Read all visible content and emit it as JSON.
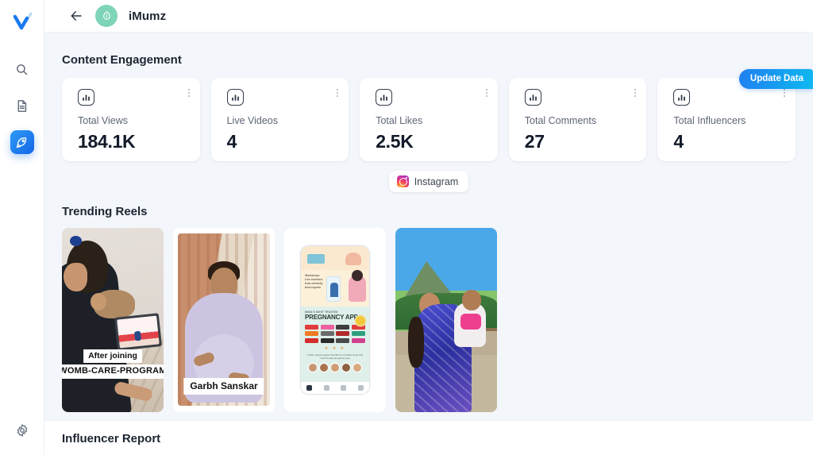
{
  "sidebar": {
    "logo_icon": "checkmark-logo",
    "items": [
      {
        "icon": "search-icon",
        "active": false
      },
      {
        "icon": "document-icon",
        "active": false
      },
      {
        "icon": "rocket-icon",
        "active": true
      }
    ],
    "bottom": {
      "icon": "gear-icon"
    }
  },
  "topbar": {
    "back_icon": "arrow-left-icon",
    "avatar_icon": "imumz-avatar-icon",
    "title": "iMumz"
  },
  "update_tab": {
    "label": "Update Data"
  },
  "sections": {
    "engagement_title": "Content Engagement",
    "reels_title": "Trending Reels",
    "report_title": "Influencer Report"
  },
  "stats": [
    {
      "icon": "bar-chart-icon",
      "label": "Total Views",
      "value": "184.1K"
    },
    {
      "icon": "bar-chart-icon",
      "label": "Live Videos",
      "value": "4"
    },
    {
      "icon": "bar-chart-icon",
      "label": "Total Likes",
      "value": "2.5K"
    },
    {
      "icon": "bar-chart-icon",
      "label": "Total Comments",
      "value": "27"
    },
    {
      "icon": "bar-chart-icon",
      "label": "Total Influencers",
      "value": "4"
    }
  ],
  "platform_filter": {
    "icon": "instagram-icon",
    "label": "Instagram"
  },
  "reels": [
    {
      "caption_line1": "After joining",
      "caption_line2": "WOMB-CARE-PROGRAM",
      "alt": "Woman sitting on floor watching a laptop with a dog beside her"
    },
    {
      "caption_line1": "Garbh Sanskar",
      "alt": "Pregnant woman meditating in a lavender top in front of curtains"
    },
    {
      "phone_kicker": "INDIA'S MOST TRUSTED",
      "phone_title": "PREGNANCY APP",
      "phone_note": "1,000+ doctors agree that iMumz is India's finest and most trusted pregnancy app",
      "alt": "Phone mockup infographic listing press logos for a pregnancy app"
    },
    {
      "alt": "Woman in a blue printed dress holding a smiling baby outdoors with a hill behind"
    }
  ],
  "colors": {
    "accent_blue": "#1566e8",
    "page_background": "#f3f6fa",
    "avatar_green": "#7ed4b8",
    "value_text": "#121a29"
  }
}
